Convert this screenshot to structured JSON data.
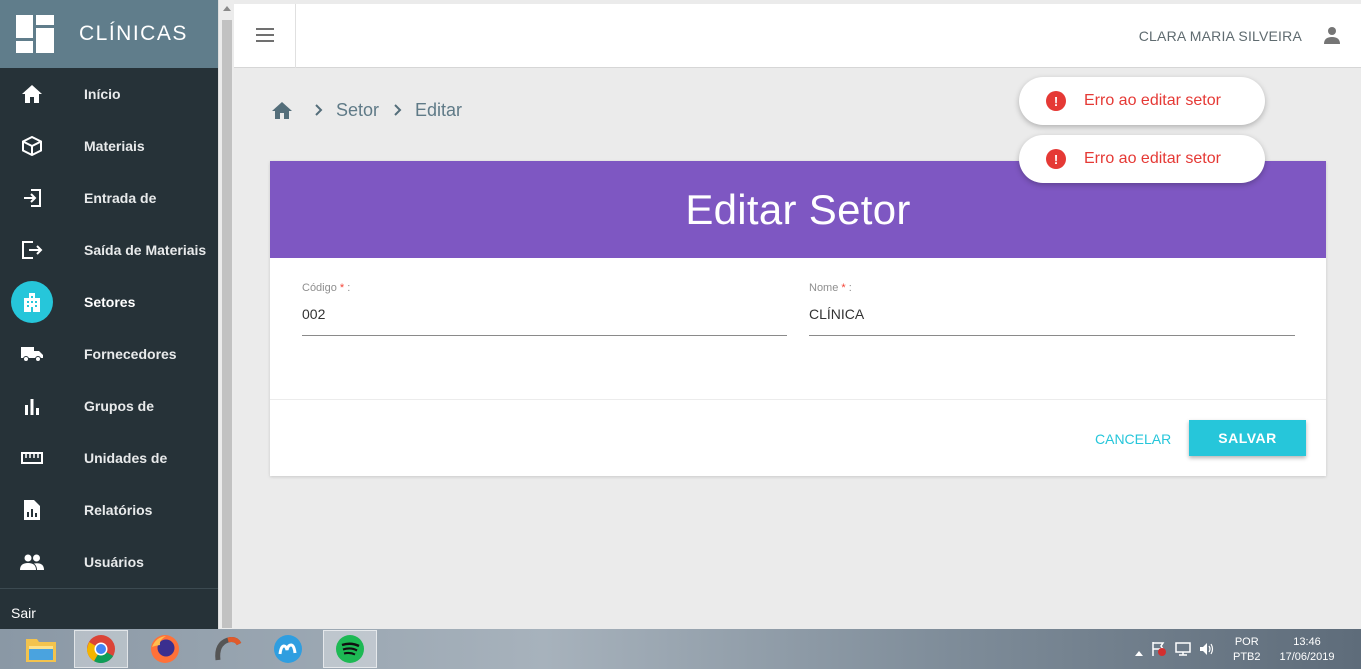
{
  "sidebar": {
    "app_name": "CLÍNICAS",
    "items": [
      {
        "label": "Início",
        "icon": "home-icon"
      },
      {
        "label": "Materiais",
        "icon": "package-icon"
      },
      {
        "label": "Entrada de",
        "icon": "login-icon"
      },
      {
        "label": "Saída de Materiais",
        "icon": "logout-icon"
      },
      {
        "label": "Setores",
        "icon": "building-icon",
        "active": true
      },
      {
        "label": "Fornecedores",
        "icon": "truck-icon"
      },
      {
        "label": "Grupos de",
        "icon": "bar-chart-icon"
      },
      {
        "label": "Unidades de",
        "icon": "ruler-icon"
      },
      {
        "label": "Relatórios",
        "icon": "report-icon"
      },
      {
        "label": "Usuários",
        "icon": "users-icon"
      }
    ],
    "logout_label": "Sair"
  },
  "header": {
    "user_name": "CLARA MARIA SILVEIRA"
  },
  "breadcrumb": {
    "items": [
      "Setor",
      "Editar"
    ]
  },
  "toasts": [
    {
      "message": "Erro ao editar setor"
    },
    {
      "message": "Erro ao editar setor"
    }
  ],
  "card": {
    "title": "Editar Setor",
    "code_label": "Código",
    "code_value": "002",
    "name_label": "Nome",
    "name_value": "CLÍNICA",
    "required_mark": "*",
    "label_suffix": ":",
    "cancel_label": "CANCELAR",
    "save_label": "SALVAR"
  },
  "taskbar": {
    "lang_top": "POR",
    "lang_bottom": "PTB2",
    "time": "13:46",
    "date": "17/06/2019"
  },
  "colors": {
    "sidebar_bg": "#263238",
    "sidebar_top": "#607d8b",
    "accent": "#26c6da",
    "card_header": "#7e57c2",
    "error": "#e53935"
  }
}
